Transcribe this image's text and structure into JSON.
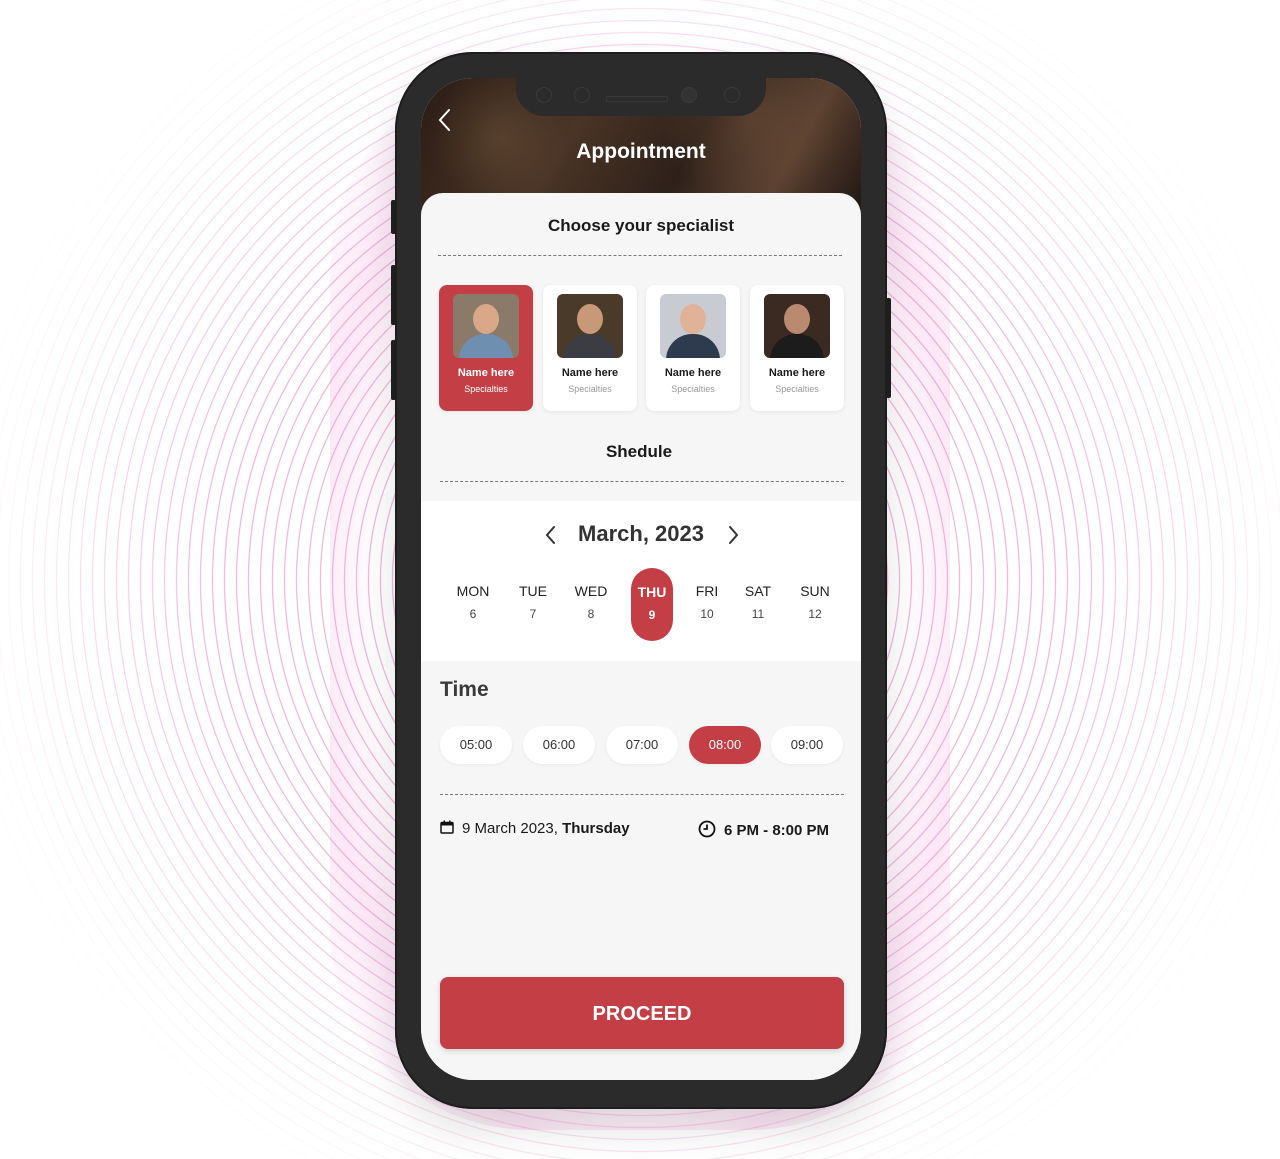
{
  "header": {
    "title": "Appointment"
  },
  "specialists_section": {
    "title": "Choose your specialist"
  },
  "specialists": [
    {
      "name": "Name here",
      "specialty": "Specialties",
      "selected": true
    },
    {
      "name": "Name here",
      "specialty": "Specialties",
      "selected": false
    },
    {
      "name": "Name here",
      "specialty": "Specialties",
      "selected": false
    },
    {
      "name": "Name here",
      "specialty": "Specialties",
      "selected": false
    }
  ],
  "schedule_section": {
    "title": "Shedule"
  },
  "calendar": {
    "month": "March, 2023",
    "days": [
      {
        "name": "MON",
        "num": "6"
      },
      {
        "name": "TUE",
        "num": "7"
      },
      {
        "name": "WED",
        "num": "8"
      },
      {
        "name": "THU",
        "num": "9"
      },
      {
        "name": "FRI",
        "num": "10"
      },
      {
        "name": "SAT",
        "num": "11"
      },
      {
        "name": "SUN",
        "num": "12"
      }
    ],
    "selected_day": "THU"
  },
  "time": {
    "title": "Time",
    "slots": [
      "05:00",
      "06:00",
      "07:00",
      "08:00",
      "09:00"
    ],
    "selected": "08:00"
  },
  "summary": {
    "date_prefix": "9 March 2023,",
    "weekday": "Thursday",
    "time_range": "6 PM - 8:00 PM"
  },
  "proceed": {
    "label": "PROCEED"
  },
  "colors": {
    "accent": "#c33f45",
    "background": "#f6f6f6",
    "phone_frame": "#2b2b2b"
  },
  "icons": [
    "back-chevron-icon",
    "chevron-left-icon",
    "chevron-right-icon",
    "calendar-icon",
    "clock-icon"
  ]
}
